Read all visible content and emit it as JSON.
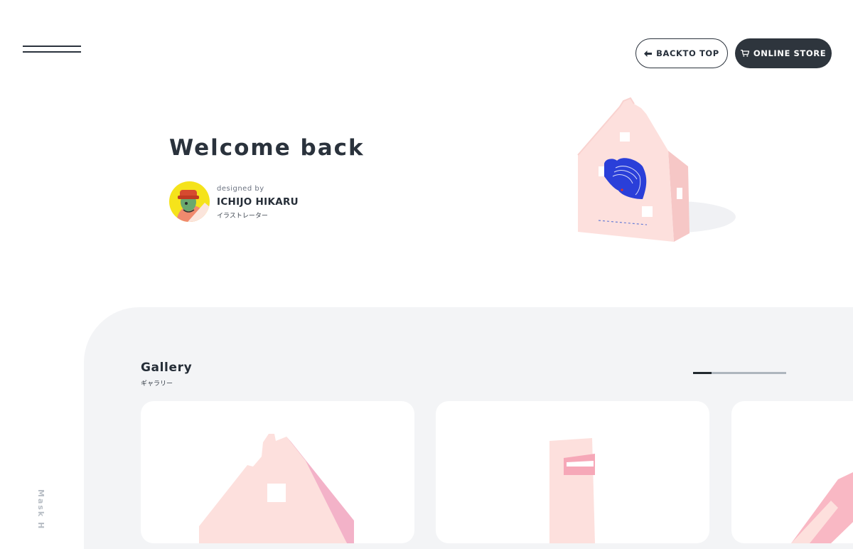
{
  "header": {
    "back_to_top_label": "BACKTO TOP",
    "online_store_label": "ONLINE STORE"
  },
  "hero": {
    "title": "Welcome back",
    "designed_by": "designed by",
    "designer_name": "ICHIJO HIKARU",
    "designer_role": "イラストレーター"
  },
  "gallery": {
    "title": "Gallery",
    "subtitle": "ギャラリー",
    "progress": 0.2
  },
  "side_label": "Mask H",
  "colors": {
    "dark": "#2e353d",
    "gallery_bg": "#f3f4f6",
    "house_pink": "#fde0dd",
    "house_shadow": "#f4b9c7",
    "accent_blue": "#2a3fd9",
    "avatar_yellow": "#f5e31b"
  },
  "icons": {
    "menu": "hamburger-icon",
    "back": "arrow-left-icon",
    "store": "cart-icon"
  }
}
